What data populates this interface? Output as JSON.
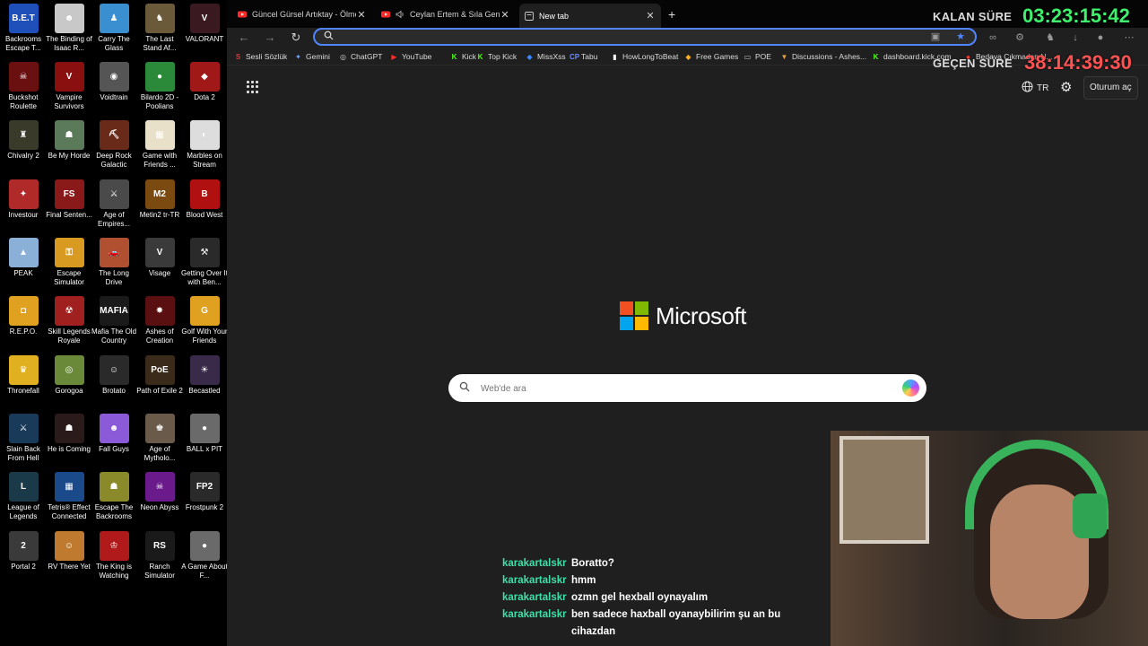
{
  "desktop": {
    "icons": [
      {
        "label": "Backrooms Escape T...",
        "color": "#1f4fb8",
        "glyph": "B.E.T"
      },
      {
        "label": "The Binding of Isaac R...",
        "color": "#c8c8c8",
        "glyph": "☻"
      },
      {
        "label": "Carry The Glass",
        "color": "#3a8fd0",
        "glyph": "♟"
      },
      {
        "label": "The Last Stand Af...",
        "color": "#6a5a3a",
        "glyph": "♞"
      },
      {
        "label": "VALORANT",
        "color": "#3a1a20",
        "glyph": "V"
      },
      {
        "label": "Buckshot Roulette",
        "color": "#6a1010",
        "glyph": "☠"
      },
      {
        "label": "Vampire Survivors",
        "color": "#8a1010",
        "glyph": "V"
      },
      {
        "label": "Voidtrain",
        "color": "#555555",
        "glyph": "◉"
      },
      {
        "label": "Bilardo 2D - Poolians",
        "color": "#2a8a3a",
        "glyph": "●"
      },
      {
        "label": "Dota 2",
        "color": "#a01818",
        "glyph": "◆"
      },
      {
        "label": "Chivalry 2",
        "color": "#3a3a2a",
        "glyph": "♜"
      },
      {
        "label": "Be My Horde",
        "color": "#5a7a5a",
        "glyph": "☗"
      },
      {
        "label": "Deep Rock Galactic",
        "color": "#6a2a1a",
        "glyph": "⛏"
      },
      {
        "label": "Game with Friends ...",
        "color": "#e8e0c8",
        "glyph": "▦"
      },
      {
        "label": "Marbles on Stream",
        "color": "#dddddd",
        "glyph": "◐"
      },
      {
        "label": "Investour",
        "color": "#b02a2a",
        "glyph": "✦"
      },
      {
        "label": "Final Senten...",
        "color": "#8a1a1a",
        "glyph": "FS"
      },
      {
        "label": "Age of Empires...",
        "color": "#4a4a4a",
        "glyph": "⚔"
      },
      {
        "label": "Metin2 tr-TR",
        "color": "#7a4a10",
        "glyph": "M2"
      },
      {
        "label": "Blood West",
        "color": "#b01010",
        "glyph": "B"
      },
      {
        "label": "PEAK",
        "color": "#8ab0d8",
        "glyph": "▲"
      },
      {
        "label": "Escape Simulator",
        "color": "#d89a20",
        "glyph": "⚿"
      },
      {
        "label": "The Long Drive",
        "color": "#b05030",
        "glyph": "🚗"
      },
      {
        "label": "Visage",
        "color": "#3a3a3a",
        "glyph": "V"
      },
      {
        "label": "Getting Over It with Ben...",
        "color": "#2a2a2a",
        "glyph": "⚒"
      },
      {
        "label": "R.E.P.O.",
        "color": "#e0a020",
        "glyph": "◘"
      },
      {
        "label": "Skill Legends Royale",
        "color": "#a02020",
        "glyph": "☢"
      },
      {
        "label": "Mafia The Old Country",
        "color": "#1a1a1a",
        "glyph": "MAFIA"
      },
      {
        "label": "Ashes of Creation",
        "color": "#5a1010",
        "glyph": "✸"
      },
      {
        "label": "Golf With Your Friends",
        "color": "#e0a020",
        "glyph": "G"
      },
      {
        "label": "Thronefall",
        "color": "#e0b020",
        "glyph": "♛"
      },
      {
        "label": "Gorogoa",
        "color": "#6a8a3a",
        "glyph": "◎"
      },
      {
        "label": "Brotato",
        "color": "#2a2a2a",
        "glyph": "☺"
      },
      {
        "label": "Path of Exile 2",
        "color": "#3a2a1a",
        "glyph": "PoE"
      },
      {
        "label": "Becastled",
        "color": "#3a2a4a",
        "glyph": "☀"
      },
      {
        "label": "Slain Back From Hell",
        "color": "#1a3a5a",
        "glyph": "⚔"
      },
      {
        "label": "He is Coming",
        "color": "#2a1a1a",
        "glyph": "☗"
      },
      {
        "label": "Fall Guys",
        "color": "#8a5ad8",
        "glyph": "☻"
      },
      {
        "label": "Age of Mytholo...",
        "color": "#6a5a4a",
        "glyph": "♚"
      },
      {
        "label": "BALL x PIT",
        "color": "#6a6a6a",
        "glyph": "●"
      },
      {
        "label": "League of Legends",
        "color": "#1a3a4a",
        "glyph": "L"
      },
      {
        "label": "Tetris® Effect Connected",
        "color": "#1a4a8a",
        "glyph": "▦"
      },
      {
        "label": "Escape The Backrooms",
        "color": "#8a8a2a",
        "glyph": "☗"
      },
      {
        "label": "Neon Abyss",
        "color": "#6a1a8a",
        "glyph": "☠"
      },
      {
        "label": "Frostpunk 2",
        "color": "#2a2a2a",
        "glyph": "FP2"
      },
      {
        "label": "Portal 2",
        "color": "#3a3a3a",
        "glyph": "2"
      },
      {
        "label": "RV There Yet",
        "color": "#c07a30",
        "glyph": "☺"
      },
      {
        "label": "The King is Watching",
        "color": "#b01a1a",
        "glyph": "♔"
      },
      {
        "label": "Ranch Simulator",
        "color": "#1a1a1a",
        "glyph": "RS"
      },
      {
        "label": "A Game About F...",
        "color": "#6a6a6a",
        "glyph": "●"
      }
    ]
  },
  "browser": {
    "tabs": [
      {
        "title": "Güncel Gürsel Artıktay - Ölmezdir",
        "fav_color": "#ff2a2a"
      },
      {
        "title": "Ceylan Ertem & Sıla Gençoğlu",
        "fav_color": "#ff2a2a"
      },
      {
        "title": "New tab",
        "fav_color": "#cfcfcf"
      }
    ],
    "new_tab_symbol": "+",
    "close_symbol": "✕",
    "address": {
      "value": "",
      "placeholder": ""
    },
    "bookmarks": [
      {
        "label": "Sesli Sözlük",
        "icon": "S",
        "color": "#d04040"
      },
      {
        "label": "Gemini",
        "icon": "✦",
        "color": "#7aa8ff"
      },
      {
        "label": "ChatGPT",
        "icon": "◎",
        "color": "#cfcfcf"
      },
      {
        "label": "YouTube",
        "icon": "▶",
        "color": "#ff2a2a"
      },
      {
        "label": "Kick",
        "icon": "K",
        "color": "#53fc18"
      },
      {
        "label": "Top Kick",
        "icon": "K",
        "color": "#53fc18"
      },
      {
        "label": "MissXss",
        "icon": "◆",
        "color": "#3a8aff"
      },
      {
        "label": "Tabu",
        "icon": "CP",
        "color": "#6a8aff"
      },
      {
        "label": "HowLongToBeat",
        "icon": "▮",
        "color": "#ffffff"
      },
      {
        "label": "Free Games",
        "icon": "◆",
        "color": "#ffb020"
      },
      {
        "label": "POE",
        "icon": "▭",
        "color": "#cfcfcf"
      },
      {
        "label": "Discussions - Ashes...",
        "icon": "▼",
        "color": "#e0a040"
      },
      {
        "label": "dashboard.kick.com",
        "icon": "K",
        "color": "#53fc18"
      },
      {
        "label": "Bedava Çıkmadan N...",
        "icon": "●",
        "color": "#ff3a3a"
      }
    ],
    "new_tab_page": {
      "apps_label": "apps",
      "lang": "TR",
      "signin": "Oturum aç",
      "brand": "Microsoft",
      "brand_colors": [
        "#f25022",
        "#7fba00",
        "#00a4ef",
        "#ffb900"
      ],
      "search_placeholder": "Web'de ara"
    }
  },
  "overlay": {
    "remaining_label": "KALAN SÜRE",
    "remaining_value": "03:23:15:42",
    "elapsed_label": "GEÇEN SÜRE",
    "elapsed_value": "38:14:39:30"
  },
  "chat": [
    {
      "user": "karakartalskr",
      "text": "Boratto?"
    },
    {
      "user": "karakartalskr",
      "text": "hmm"
    },
    {
      "user": "karakartalskr",
      "text": "ozmn gel hexball oynayalım"
    },
    {
      "user": "karakartalskr",
      "text": "ben sadece haxball oyanaybilirim şu an bu cihazdan"
    }
  ]
}
